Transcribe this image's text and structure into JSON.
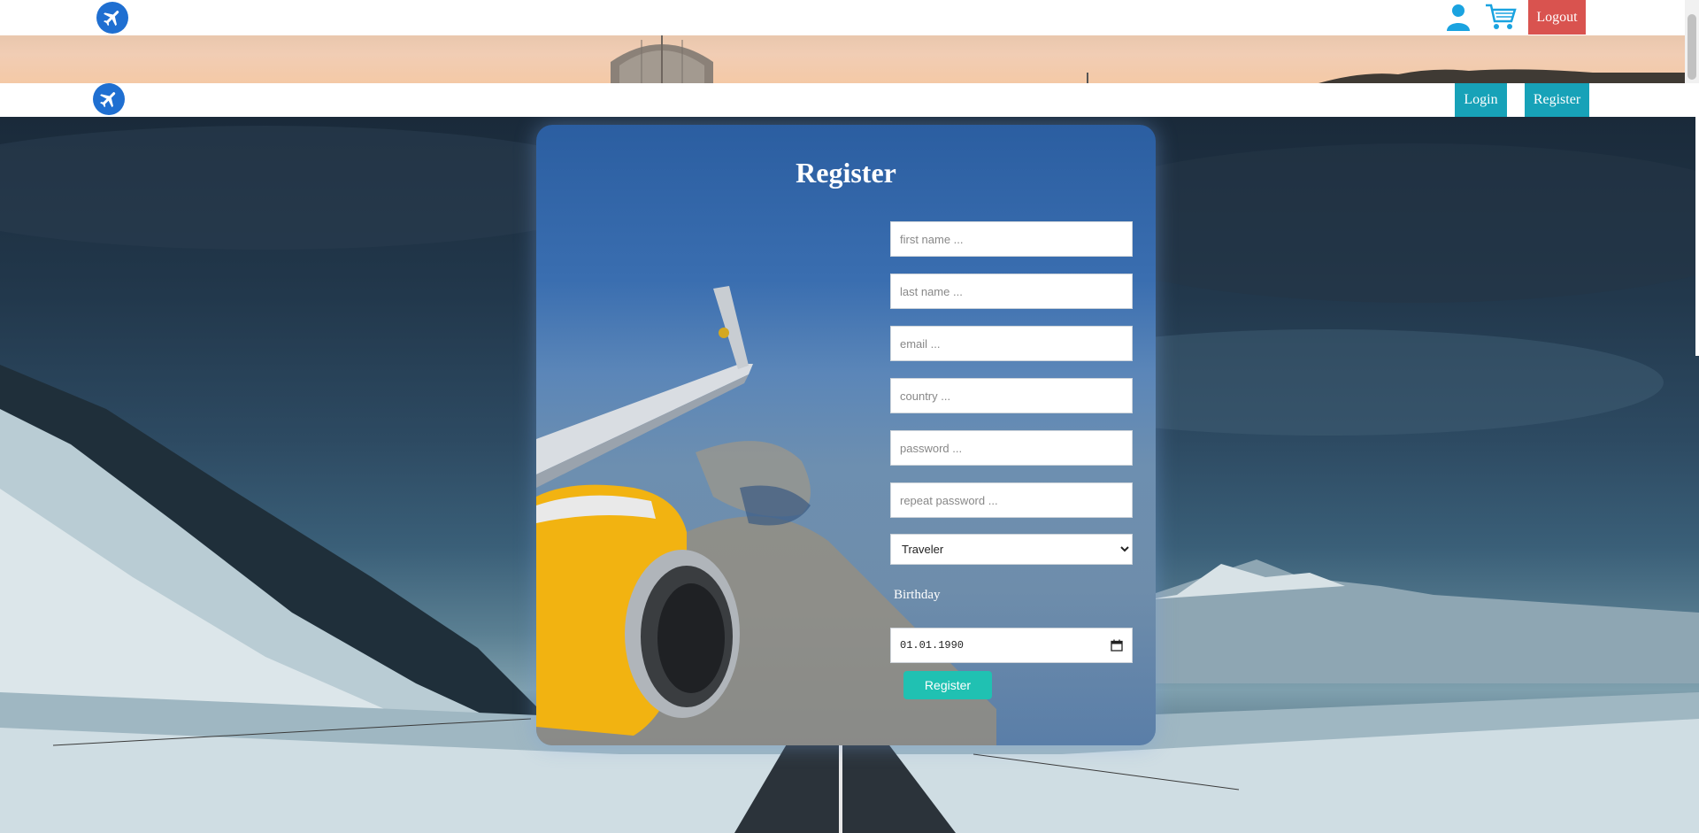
{
  "topbar": {
    "logo_icon": "airplane-icon",
    "user_icon": "user-icon",
    "cart_icon": "cart-icon",
    "logout_label": "Logout"
  },
  "navbar": {
    "logo_icon": "airplane-icon",
    "login_label": "Login",
    "register_label": "Register"
  },
  "form": {
    "title": "Register",
    "first_name_placeholder": "first name ...",
    "last_name_placeholder": "last name ...",
    "email_placeholder": "email ...",
    "country_placeholder": "country ...",
    "password_placeholder": "password ...",
    "repeat_password_placeholder": "repeat password ...",
    "role_selected": "Traveler",
    "birthday_label": "Birthday",
    "birthday_value": "01.01.1990",
    "submit_label": "Register"
  },
  "colors": {
    "logout": "#d9534f",
    "nav_button": "#17a2b8",
    "submit_button": "#20c1b2",
    "logo": "#1f6fd1",
    "icons": "#1aa3e0"
  }
}
